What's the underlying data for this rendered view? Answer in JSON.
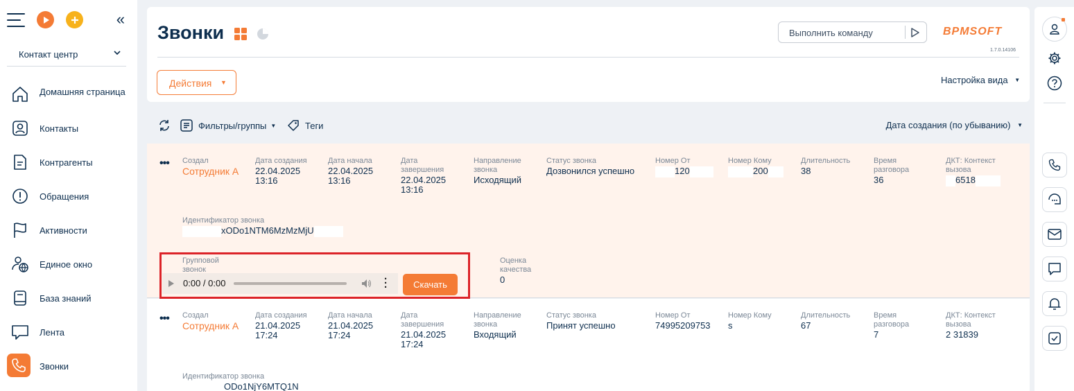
{
  "sidebar": {
    "workspace": "Контакт центр",
    "items": [
      {
        "label": "Домашняя страница",
        "icon": "home-icon"
      },
      {
        "label": "Контакты",
        "icon": "contact-icon"
      },
      {
        "label": "Контрагенты",
        "icon": "document-icon"
      },
      {
        "label": "Обращения",
        "icon": "alert-icon"
      },
      {
        "label": "Активности",
        "icon": "flag-icon"
      },
      {
        "label": "Единое окно",
        "icon": "globe-user-icon"
      },
      {
        "label": "База знаний",
        "icon": "book-icon"
      },
      {
        "label": "Лента",
        "icon": "chat-icon"
      },
      {
        "label": "Звонки",
        "icon": "phone-icon"
      }
    ]
  },
  "header": {
    "title": "Звонки",
    "command_placeholder": "Выполнить команду",
    "logo": "BPMSOFT",
    "version": "1.7.0.14106",
    "actions_label": "Действия",
    "view_settings": "Настройка вида"
  },
  "toolbar": {
    "filters": "Фильтры/группы",
    "tags": "Теги",
    "sort": "Дата создания (по убыванию)"
  },
  "labels": {
    "created_by": "Создал",
    "created_date": "Дата создания",
    "start_date": "Дата начала",
    "end_date": "Дата завершения",
    "direction": "Направление звонка",
    "status": "Статус звонка",
    "from": "Номер От",
    "to": "Номер Кому",
    "duration": "Длительность",
    "talk_time": "Время разговора",
    "dkt": "ДКТ: Контекст вызова",
    "call_id": "Идентификатор звонка",
    "group_call": "Групповой звонок",
    "quality": "Оценка качества"
  },
  "records": [
    {
      "created_by": "Сотрудник А",
      "created_date": "22.04.2025",
      "created_time": "13:16",
      "start_date": "22.04.2025",
      "start_time": "13:16",
      "end_date": "22.04.2025",
      "end_time": "13:16",
      "direction": "Исходящий",
      "status": "Дозвонился успешно",
      "from": "120",
      "to": "200",
      "duration": "38",
      "talk_time": "36",
      "dkt": "6518",
      "call_id": "xODo1NTM6MzMzMjU",
      "quality": "0",
      "player_time": "0:00 / 0:00",
      "download": "Скачать"
    },
    {
      "created_by": "Сотрудник А",
      "created_date": "21.04.2025",
      "created_time": "17:24",
      "start_date": "21.04.2025",
      "start_time": "17:24",
      "end_date": "21.04.2025",
      "end_time": "17:24",
      "direction": "Входящий",
      "status": "Принят успешно",
      "from": "74995209753",
      "to": "s",
      "duration": "67",
      "talk_time": "7",
      "dkt": "2 31839",
      "call_id": "ODo1NjY6MTQ1N"
    }
  ],
  "colors": {
    "accent": "#f47b35",
    "text": "#0d2e4e",
    "highlight": "#fff3ec",
    "frame": "#dc2328"
  }
}
